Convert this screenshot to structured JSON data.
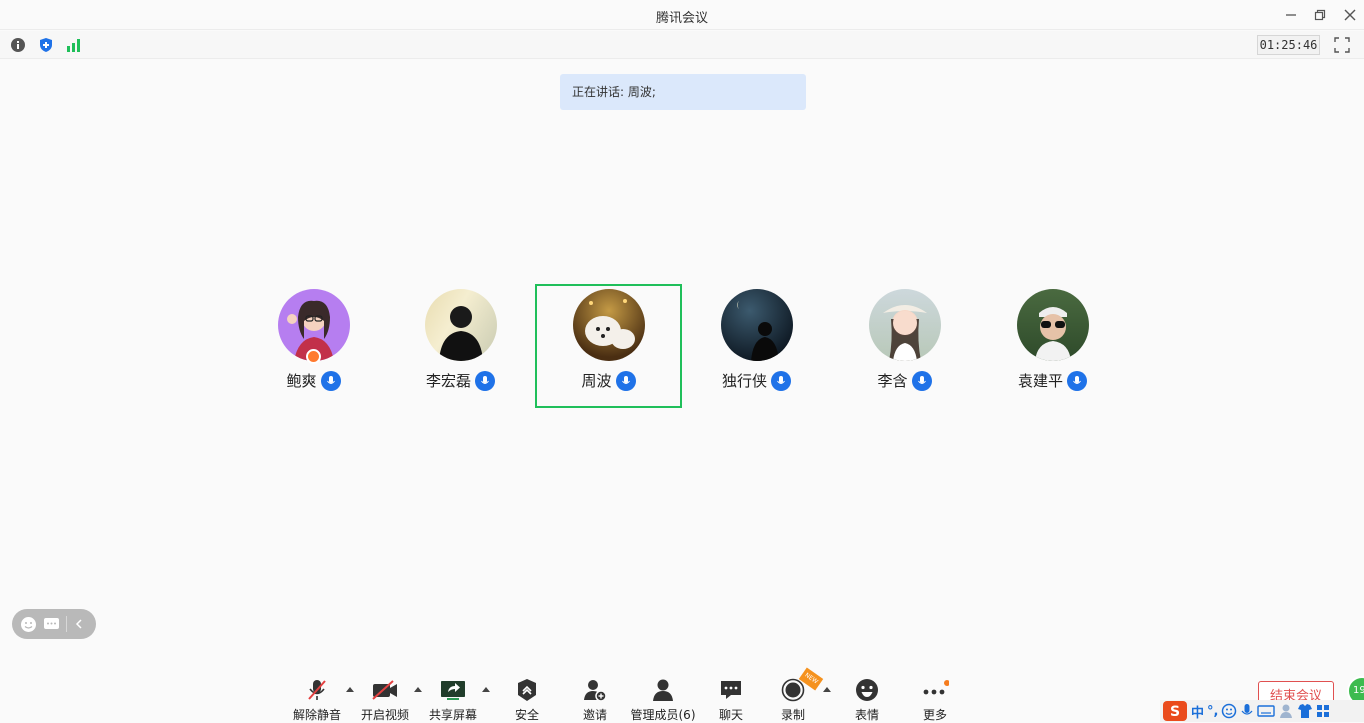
{
  "window": {
    "title": "腾讯会议"
  },
  "toolbar": {
    "timer": "01:25:46"
  },
  "speaking": {
    "text": "正在讲话: 周波;"
  },
  "participants": [
    {
      "name": "鲍爽",
      "host": true,
      "active": false
    },
    {
      "name": "李宏磊",
      "host": false,
      "active": false
    },
    {
      "name": "周波",
      "host": false,
      "active": true
    },
    {
      "name": "独行侠",
      "host": false,
      "active": false
    },
    {
      "name": "李含",
      "host": false,
      "active": false
    },
    {
      "name": "袁建平",
      "host": false,
      "active": false
    }
  ],
  "controls": {
    "unmute": "解除静音",
    "video": "开启视频",
    "share": "共享屏幕",
    "security": "安全",
    "invite": "邀请",
    "members": "管理成员(6)",
    "chat": "聊天",
    "record": "录制",
    "record_badge": "NEW",
    "emoji": "表情",
    "more": "更多"
  },
  "end_meeting": "结束会议",
  "ime": {
    "lang": "中",
    "punct": "°,"
  },
  "colors": {
    "accent": "#1f72e8",
    "active_border": "#1fbf5a",
    "end": "#e05050",
    "speaking_bg": "#dbe8fb"
  }
}
